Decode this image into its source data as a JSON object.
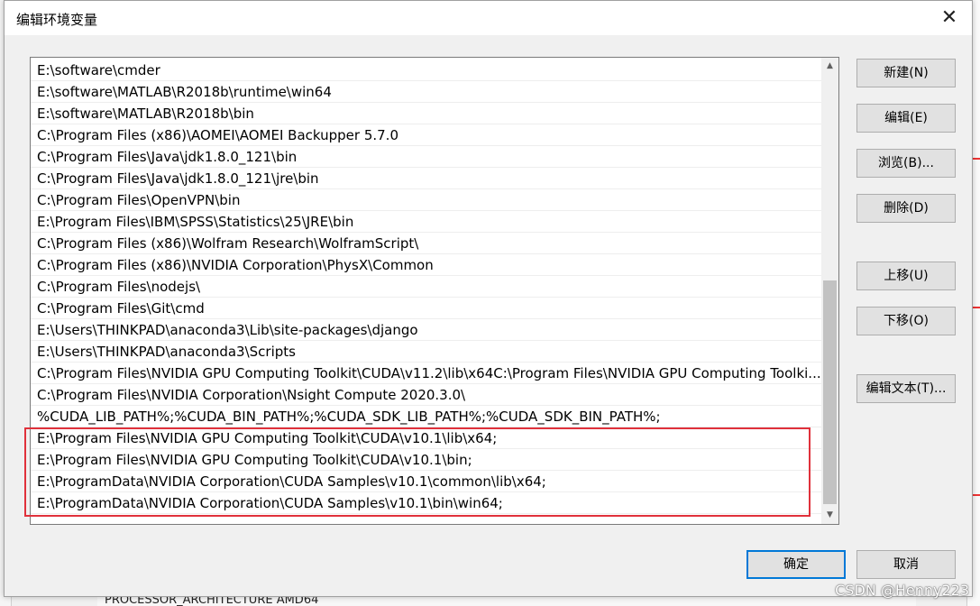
{
  "dialog": {
    "title": "编辑环境变量",
    "close_glyph": "✕"
  },
  "paths": [
    "E:\\software\\cmder",
    "E:\\software\\MATLAB\\R2018b\\runtime\\win64",
    "E:\\software\\MATLAB\\R2018b\\bin",
    "C:\\Program Files (x86)\\AOMEI\\AOMEI Backupper 5.7.0",
    "C:\\Program Files\\Java\\jdk1.8.0_121\\bin",
    "C:\\Program Files\\Java\\jdk1.8.0_121\\jre\\bin",
    "C:\\Program Files\\OpenVPN\\bin",
    "E:\\Program Files\\IBM\\SPSS\\Statistics\\25\\JRE\\bin",
    "C:\\Program Files (x86)\\Wolfram Research\\WolframScript\\",
    "C:\\Program Files (x86)\\NVIDIA Corporation\\PhysX\\Common",
    "C:\\Program Files\\nodejs\\",
    "C:\\Program Files\\Git\\cmd",
    "E:\\Users\\THINKPAD\\anaconda3\\Lib\\site-packages\\django",
    "E:\\Users\\THINKPAD\\anaconda3\\Scripts",
    "C:\\Program Files\\NVIDIA GPU Computing Toolkit\\CUDA\\v11.2\\lib\\x64C:\\Program Files\\NVIDIA GPU Computing Toolki...",
    "C:\\Program Files\\NVIDIA Corporation\\Nsight Compute 2020.3.0\\",
    "%CUDA_LIB_PATH%;%CUDA_BIN_PATH%;%CUDA_SDK_LIB_PATH%;%CUDA_SDK_BIN_PATH%;",
    "E:\\Program Files\\NVIDIA GPU Computing Toolkit\\CUDA\\v10.1\\lib\\x64;",
    "E:\\Program Files\\NVIDIA GPU Computing Toolkit\\CUDA\\v10.1\\bin;",
    "E:\\ProgramData\\NVIDIA Corporation\\CUDA Samples\\v10.1\\common\\lib\\x64;",
    "E:\\ProgramData\\NVIDIA Corporation\\CUDA Samples\\v10.1\\bin\\win64;"
  ],
  "scrollbar": {
    "up_glyph": "▲",
    "down_glyph": "▼"
  },
  "buttons": {
    "new": "新建(N)",
    "edit": "编辑(E)",
    "browse": "浏览(B)...",
    "delete": "删除(D)",
    "move_up": "上移(U)",
    "move_down": "下移(O)",
    "edit_text": "编辑文本(T)...",
    "ok": "确定",
    "cancel": "取消"
  },
  "background": {
    "bottom_text": "PROCESSOR_ARCHITECTURE  AMD64"
  },
  "watermark": "CSDN @Henny223",
  "colors": {
    "highlight": "#e0313b",
    "primary_border": "#0078d7"
  }
}
